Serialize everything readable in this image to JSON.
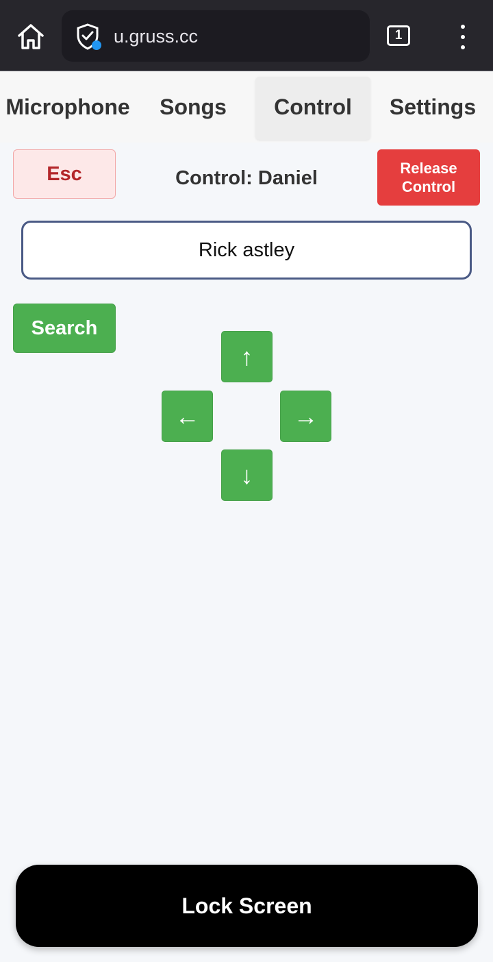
{
  "browser": {
    "url": "u.gruss.cc",
    "tab_count": "1",
    "icons": [
      "home-icon",
      "shield-check-icon",
      "tabs-icon",
      "more-vert-icon"
    ]
  },
  "tabs": [
    {
      "label": "Microphone"
    },
    {
      "label": "Songs"
    },
    {
      "label": "Control",
      "active": true
    },
    {
      "label": "Settings"
    }
  ],
  "controls": {
    "esc_label": "Esc",
    "status_label": "Control: Daniel",
    "release_label": "Release Control",
    "search_value": "Rick astley",
    "search_button": "Search",
    "arrows": {
      "up": "↑",
      "left": "←",
      "right": "→",
      "down": "↓"
    },
    "lock_label": "Lock Screen"
  },
  "colors": {
    "primary_green": "#4caf50",
    "release_red": "#e53e3e",
    "esc_red": "#b3262a",
    "lock_black": "#000000"
  }
}
